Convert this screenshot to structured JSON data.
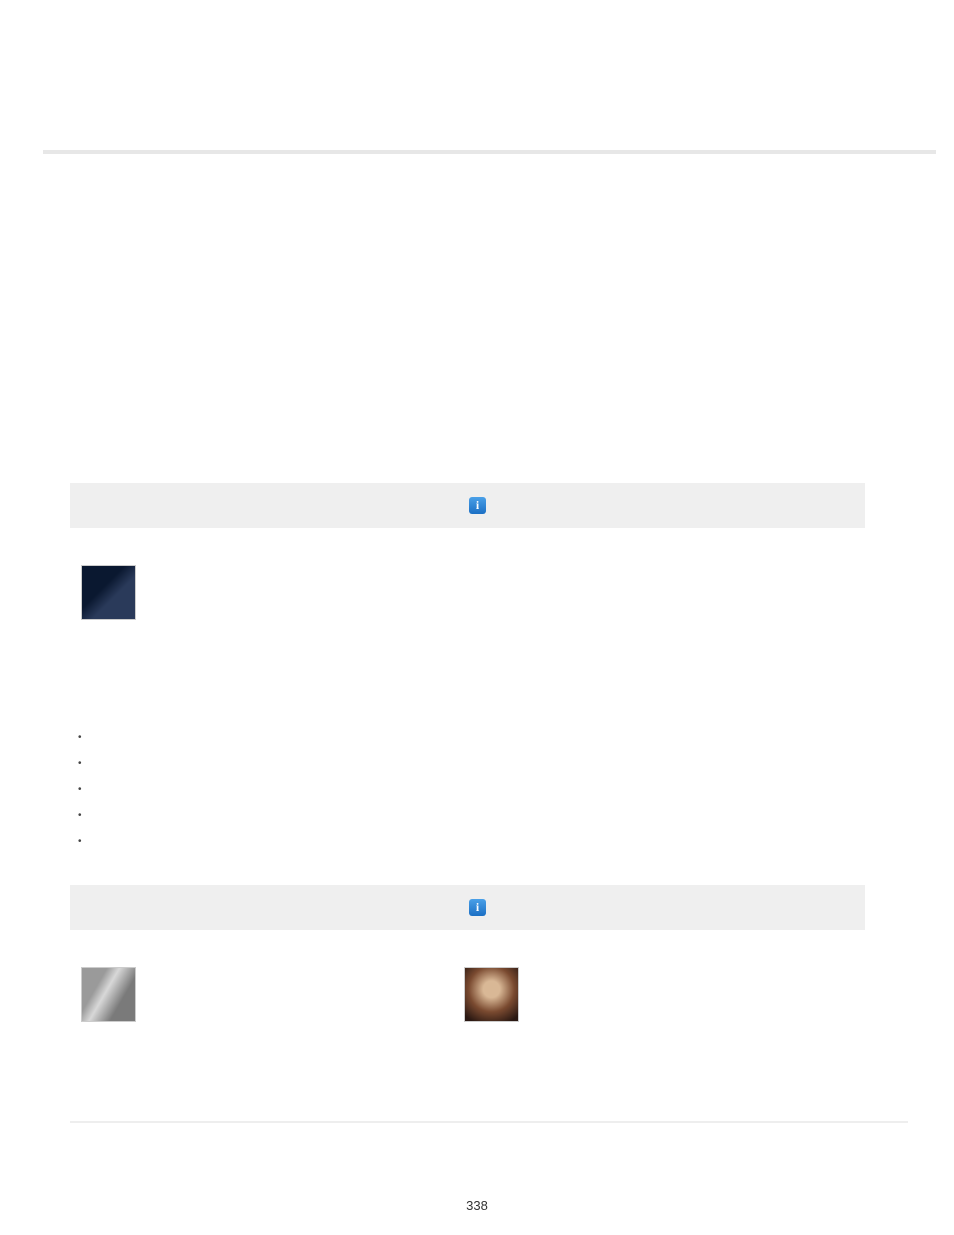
{
  "page_number": "338",
  "info_icon_glyph": "i",
  "bullets": [
    "",
    "",
    "",
    "",
    ""
  ]
}
